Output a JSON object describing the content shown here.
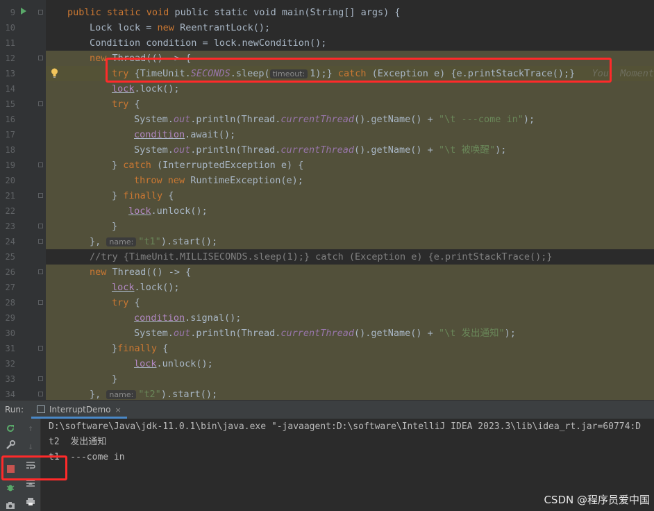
{
  "editor": {
    "lines": [
      {
        "n": "9",
        "hl": false
      },
      {
        "n": "10",
        "hl": false
      },
      {
        "n": "11",
        "hl": false
      },
      {
        "n": "12",
        "hl": true
      },
      {
        "n": "13",
        "hl": true,
        "current": true
      },
      {
        "n": "14",
        "hl": true
      },
      {
        "n": "15",
        "hl": true
      },
      {
        "n": "16",
        "hl": true
      },
      {
        "n": "17",
        "hl": true
      },
      {
        "n": "18",
        "hl": true
      },
      {
        "n": "19",
        "hl": true
      },
      {
        "n": "20",
        "hl": true
      },
      {
        "n": "21",
        "hl": true
      },
      {
        "n": "22",
        "hl": true
      },
      {
        "n": "23",
        "hl": true
      },
      {
        "n": "24",
        "hl": true
      },
      {
        "n": "25",
        "hl": false
      },
      {
        "n": "26",
        "hl": true
      },
      {
        "n": "27",
        "hl": true
      },
      {
        "n": "28",
        "hl": true
      },
      {
        "n": "29",
        "hl": true
      },
      {
        "n": "30",
        "hl": true
      },
      {
        "n": "31",
        "hl": true
      },
      {
        "n": "32",
        "hl": true
      },
      {
        "n": "33",
        "hl": true
      },
      {
        "n": "34",
        "hl": true
      }
    ],
    "code": {
      "l9": "public static void main(String[] args) {",
      "l10a": "Lock lock = ",
      "l10b": "new ",
      "l10c": "ReentrantLock();",
      "l11": "Condition condition = lock.newCondition();",
      "l12a": "new ",
      "l12b": "Thread(() -> {",
      "l13a": "try ",
      "l13b": "{TimeUnit.",
      "l13c": "SECONDS",
      "l13d": ".sleep(",
      "l13hint": "timeout:",
      "l13e": "1);} ",
      "l13f": "catch ",
      "l13g": "(Exception e) {e.printStackTrace();}",
      "l13blame": "You, Moments",
      "l14a": "lock",
      "l14b": ".lock();",
      "l15a": "try ",
      "l15b": "{",
      "l16a": "System.",
      "l16b": "out",
      "l16c": ".println(Thread.",
      "l16d": "currentThread",
      "l16e": "().getName() + ",
      "l16f": "\"\\t ---come in\"",
      "l16g": ");",
      "l17a": "condition",
      "l17b": ".await();",
      "l18a": "System.",
      "l18b": "out",
      "l18c": ".println(Thread.",
      "l18d": "currentThread",
      "l18e": "().getName() + ",
      "l18f": "\"\\t 被唤醒\"",
      "l18g": ");",
      "l19a": "} ",
      "l19b": "catch ",
      "l19c": "(InterruptedException e) {",
      "l20a": "throw new ",
      "l20b": "RuntimeException(e);",
      "l21a": "} ",
      "l21b": "finally ",
      "l21c": "{",
      "l22a": "lock",
      "l22b": ".unlock();",
      "l23": "}",
      "l24a": "}, ",
      "l24hint": "name:",
      "l24b": "\"t1\"",
      "l24c": ").start();",
      "l25": "//try {TimeUnit.MILLISECONDS.sleep(1);} catch (Exception e) {e.printStackTrace();}",
      "l26a": "new ",
      "l26b": "Thread(() -> {",
      "l27a": "lock",
      "l27b": ".lock();",
      "l28a": "try ",
      "l28b": "{",
      "l29a": "condition",
      "l29b": ".signal();",
      "l30a": "System.",
      "l30b": "out",
      "l30c": ".println(Thread.",
      "l30d": "currentThread",
      "l30e": "().getName() + ",
      "l30f": "\"\\t 发出通知\"",
      "l30g": ");",
      "l31a": "}",
      "l31b": "finally ",
      "l31c": "{",
      "l32a": "lock",
      "l32b": ".unlock();",
      "l33": "}",
      "l34a": "}, ",
      "l34hint": "name:",
      "l34b": "\"t2\"",
      "l34c": ").start();"
    }
  },
  "run": {
    "label": "Run:",
    "tab": "InterruptDemo",
    "tab_close": "×",
    "console": [
      "D:\\software\\Java\\jdk-11.0.1\\bin\\java.exe \"-javaagent:D:\\software\\IntelliJ IDEA 2023.3\\lib\\idea_rt.jar=60774:D",
      "t2  发出通知",
      "t1  ---come in"
    ]
  },
  "watermark": "CSDN @程序员爱中国",
  "colors": {
    "highlight": "#52503a",
    "red_box": "#ff2a2a",
    "accent": "#4a88c7"
  }
}
